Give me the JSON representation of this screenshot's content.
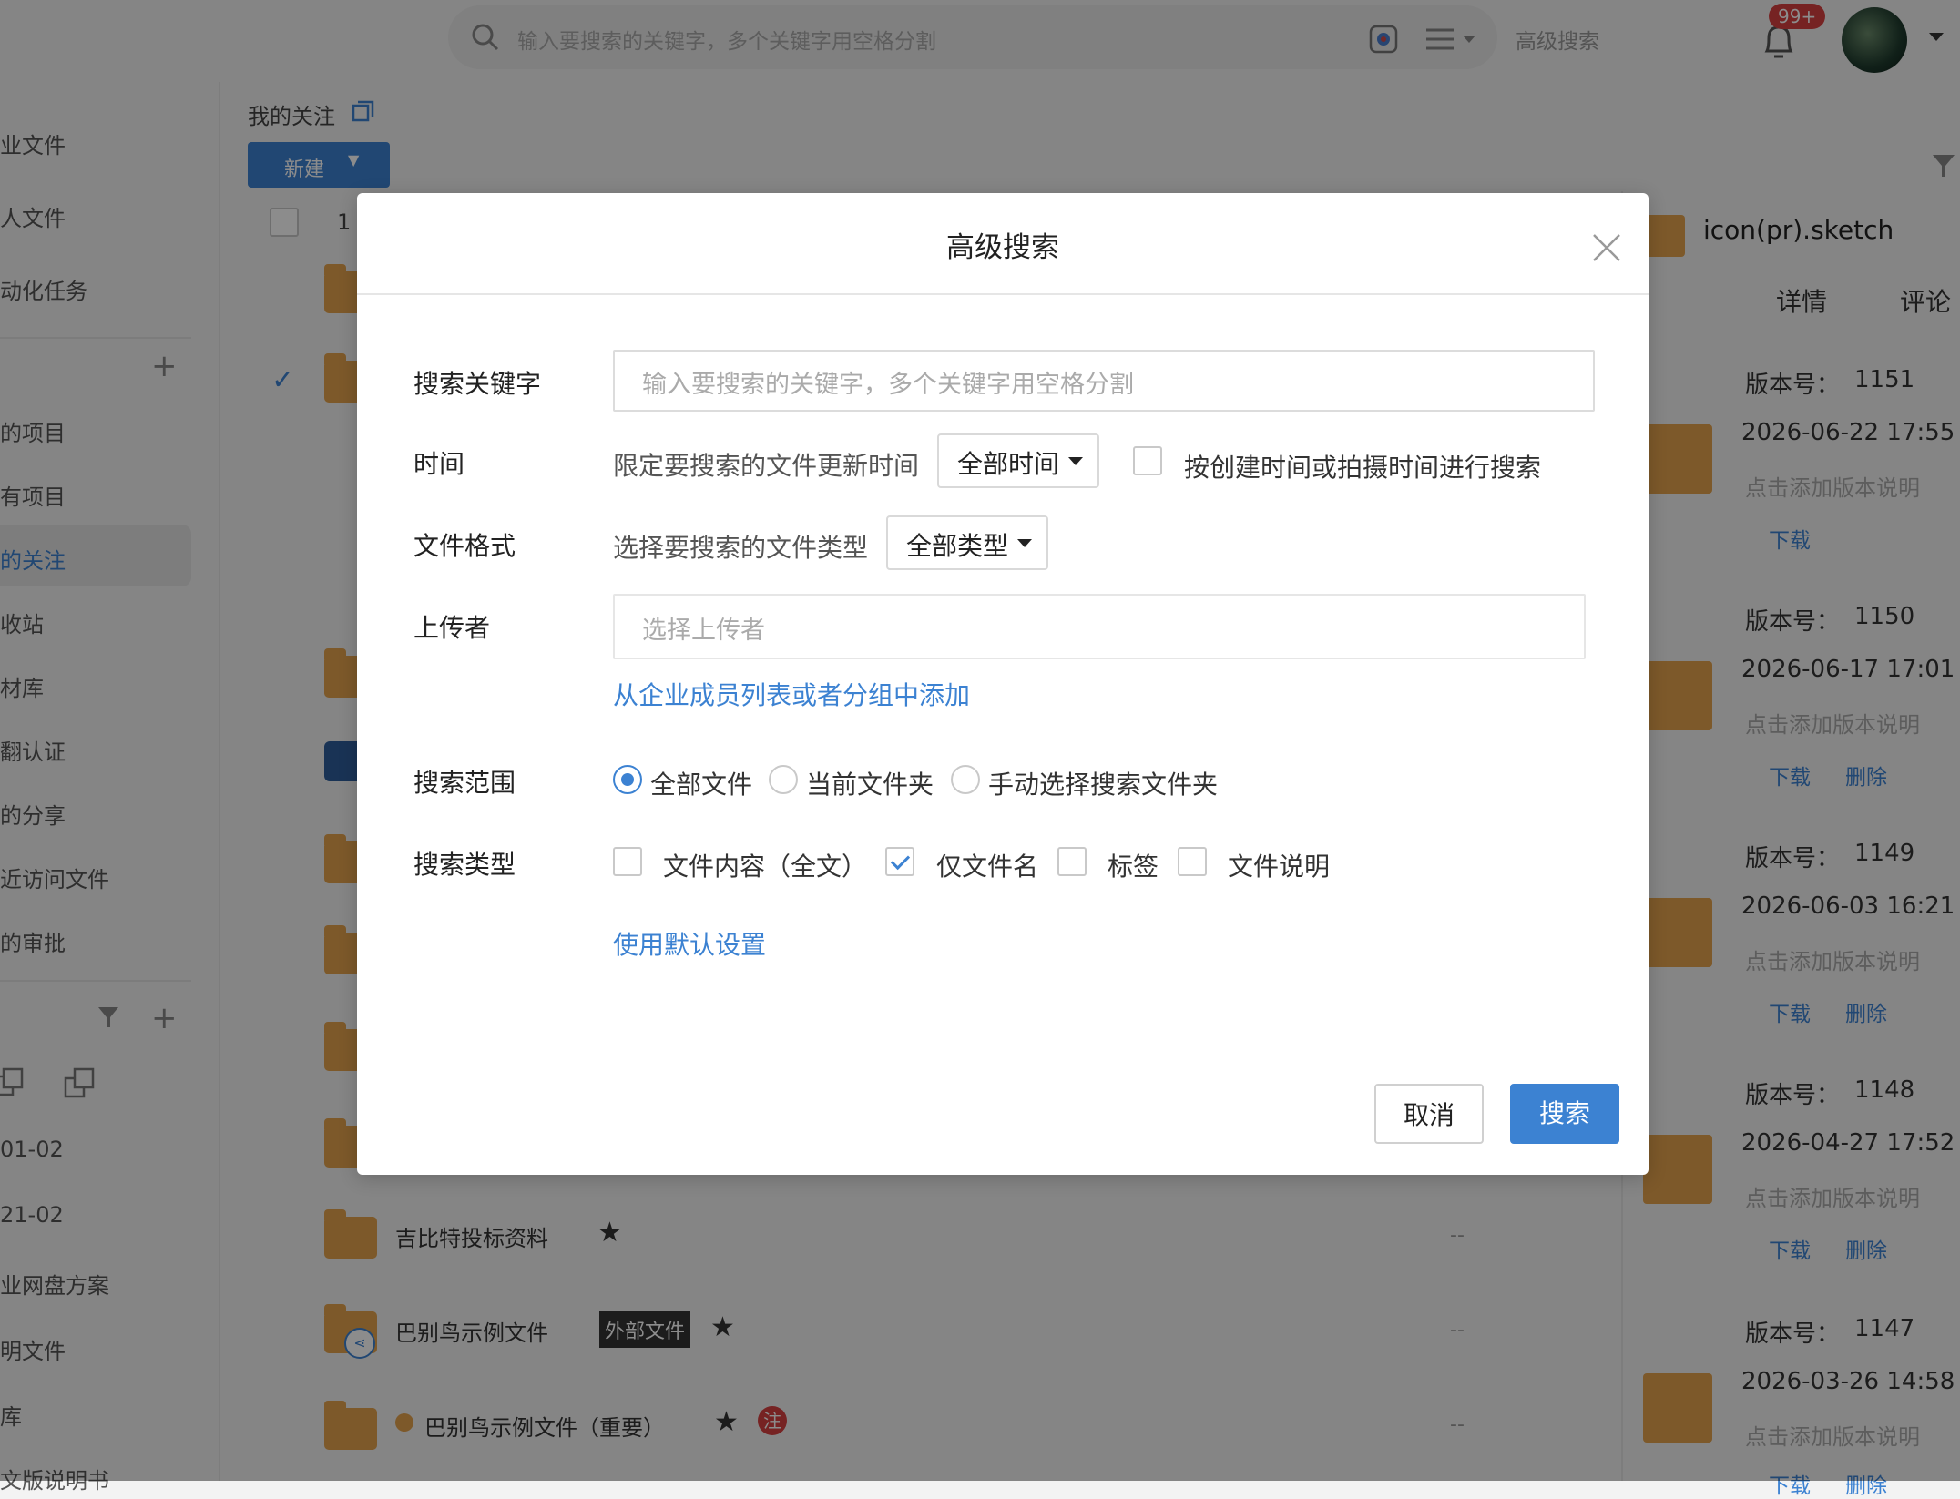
{
  "topbar": {
    "search_placeholder": "输入要搜索的关键字，多个关键字用空格分割",
    "advanced_search_label": "高级搜索",
    "notification_count": "99+"
  },
  "sidebar": {
    "items": [
      {
        "label": "业文件",
        "active": false
      },
      {
        "label": "人文件",
        "active": false
      },
      {
        "label": "动化任务",
        "active": false
      },
      {
        "label": "的项目",
        "active": false
      },
      {
        "label": "有项目",
        "active": false
      },
      {
        "label": "的关注",
        "active": true
      },
      {
        "label": "收站",
        "active": false
      },
      {
        "label": "材库",
        "active": false
      },
      {
        "label": "翻认证",
        "active": false
      },
      {
        "label": "的分享",
        "active": false
      },
      {
        "label": "近访问文件",
        "active": false
      },
      {
        "label": "的审批",
        "active": false
      }
    ],
    "groups": [
      "01-02",
      "21-02",
      "业网盘方案",
      "明文件",
      "库",
      "文版说明书"
    ]
  },
  "main": {
    "breadcrumb": "我的关注",
    "new_button": "新建",
    "count_partial": "1",
    "rows": [
      {
        "name": "吉比特投标资料",
        "tag": "",
        "date": "--"
      },
      {
        "name": "巴别鸟示例文件",
        "tag": "外部文件",
        "date": "--"
      },
      {
        "name": "巴别鸟示例文件（重要）",
        "tag": "注",
        "date": "--"
      }
    ]
  },
  "right_panel": {
    "file_name": "icon(pr).sketch",
    "tabs": [
      "详情",
      "评论"
    ],
    "versions": [
      {
        "label": "版本号：",
        "num": "1151",
        "date": "2026-06-22 17:55",
        "desc": "点击添加版本说明",
        "actions": [
          "下载"
        ]
      },
      {
        "label": "版本号：",
        "num": "1150",
        "date": "2026-06-17 17:01",
        "desc": "点击添加版本说明",
        "actions": [
          "下载",
          "删除"
        ]
      },
      {
        "label": "版本号：",
        "num": "1149",
        "date": "2026-06-03 16:21",
        "desc": "点击添加版本说明",
        "actions": [
          "下载",
          "删除"
        ]
      },
      {
        "label": "版本号：",
        "num": "1148",
        "date": "2026-04-27 17:52",
        "desc": "点击添加版本说明",
        "actions": [
          "下载",
          "删除"
        ]
      },
      {
        "label": "版本号：",
        "num": "1147",
        "date": "2026-03-26 14:58",
        "desc": "点击添加版本说明",
        "actions": [
          "下载",
          "删除"
        ]
      }
    ]
  },
  "modal": {
    "title": "高级搜索",
    "keyword_label": "搜索关键字",
    "keyword_placeholder": "输入要搜索的关键字，多个关键字用空格分割",
    "time_label": "时间",
    "time_hint": "限定要搜索的文件更新时间",
    "time_select": "全部时间",
    "time_checkbox_label": "按创建时间或拍摄时间进行搜索",
    "time_checkbox_checked": false,
    "format_label": "文件格式",
    "format_hint": "选择要搜索的文件类型",
    "format_select": "全部类型",
    "uploader_label": "上传者",
    "uploader_placeholder": "选择上传者",
    "uploader_link": "从企业成员列表或者分组中添加",
    "scope_label": "搜索范围",
    "scope_options": [
      {
        "label": "全部文件",
        "selected": true
      },
      {
        "label": "当前文件夹",
        "selected": false
      },
      {
        "label": "手动选择搜索文件夹",
        "selected": false
      }
    ],
    "type_label": "搜索类型",
    "type_options": [
      {
        "label": "文件内容（全文）",
        "checked": false
      },
      {
        "label": "仅文件名",
        "checked": true
      },
      {
        "label": "标签",
        "checked": false
      },
      {
        "label": "文件说明",
        "checked": false
      }
    ],
    "default_link": "使用默认设置",
    "cancel_button": "取消",
    "search_button": "搜索"
  }
}
